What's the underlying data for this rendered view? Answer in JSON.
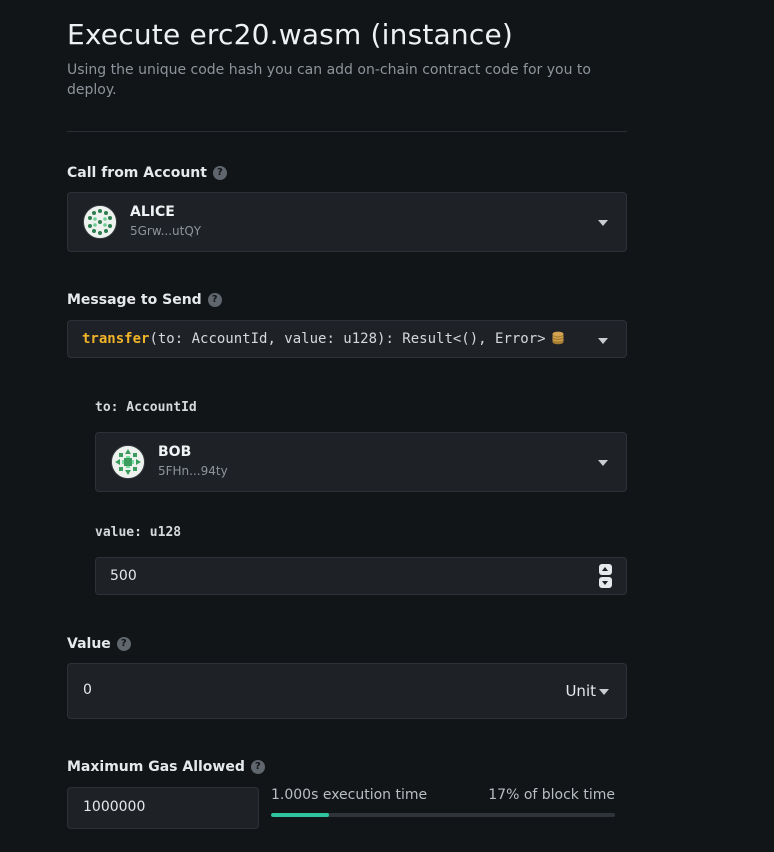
{
  "header": {
    "title": "Execute erc20.wasm (instance)",
    "subtitle": "Using the unique code hash you can add on-chain contract code for you to deploy."
  },
  "call_from": {
    "label": "Call from Account",
    "help_icon": "question-circle-icon",
    "account_name": "ALICE",
    "account_address": "5Grw...utQY"
  },
  "message": {
    "label": "Message to Send",
    "help_icon": "question-circle-icon",
    "fn_name": "transfer",
    "signature": "(to: AccountId, value: u128): Result<(), Error>",
    "mutates_icon": "database-coins-icon"
  },
  "args": {
    "to": {
      "label": "to: AccountId",
      "account_name": "BOB",
      "account_address": "5FHn...94ty"
    },
    "value": {
      "label": "value: u128",
      "value": "500"
    }
  },
  "value_field": {
    "label": "Value",
    "help_icon": "question-circle-icon",
    "value": "0",
    "unit": "Unit"
  },
  "gas": {
    "label": "Maximum Gas Allowed",
    "help_icon": "question-circle-icon",
    "value": "1000000",
    "execution_time": "1.000s execution time",
    "block_time": "17% of block time",
    "block_fraction": 0.17
  },
  "colors": {
    "background": "#121518",
    "panel": "#1e2226",
    "accent_fn": "#f0b429",
    "progress": "#2ec4a0"
  }
}
